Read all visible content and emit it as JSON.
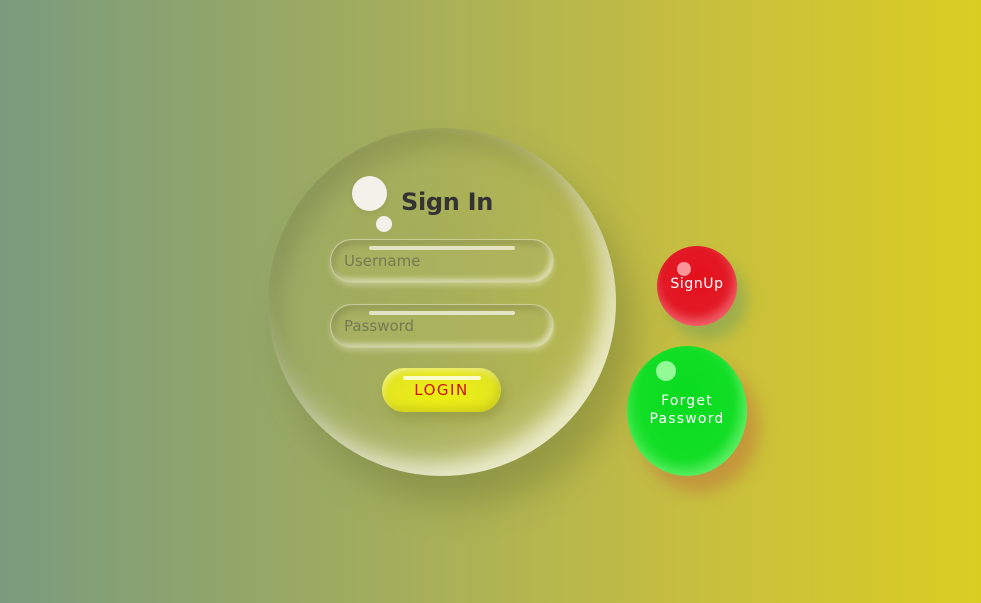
{
  "signin_card": {
    "title": "Sign In",
    "username": {
      "placeholder": "Username",
      "value": ""
    },
    "password": {
      "placeholder": "Password",
      "value": ""
    },
    "login_label": "LOGIN"
  },
  "side_buttons": {
    "signup_label": "SignUp",
    "forget_line1": "Forget",
    "forget_line2": "Password"
  },
  "colors": {
    "background_start": "#7a9b7e",
    "background_end": "#dacd22",
    "login_button": "#e8eb12",
    "login_text": "#d01010",
    "signup_button": "#e4101c",
    "forget_button": "#0cdc20",
    "title_text": "#333333"
  },
  "icons": {
    "decor_big": "bubble-decoration-icon",
    "decor_small": "bubble-decoration-small-icon"
  }
}
